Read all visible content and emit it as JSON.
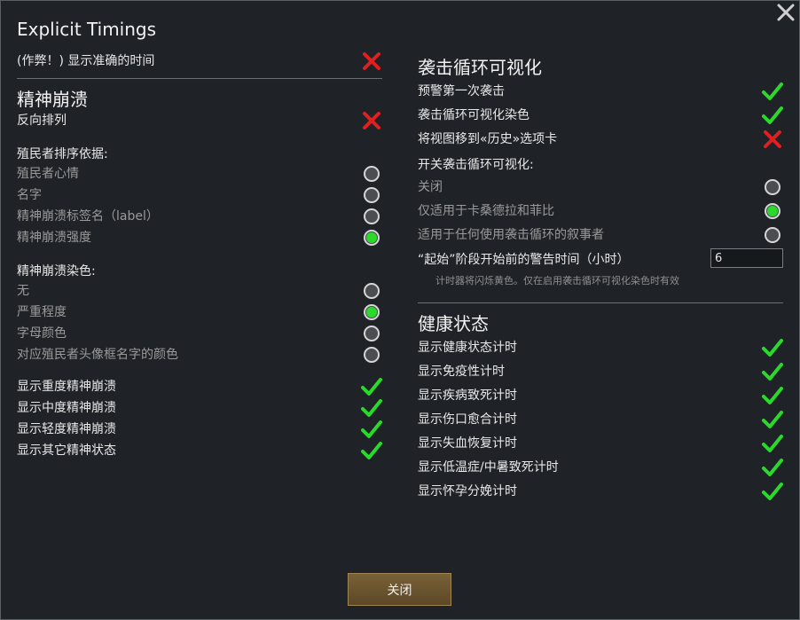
{
  "title": "Explicit Timings",
  "close_button_label": "关闭",
  "left": {
    "cheat_row": {
      "label": "(作弊！) 显示准确的时间",
      "state": "off"
    },
    "mental_header": "精神崩溃",
    "reverse_row": {
      "label": "反向排列",
      "state": "off"
    },
    "sort_header": "殖民者排序依据:",
    "sort_options": [
      {
        "label": "殖民者心情",
        "selected": false
      },
      {
        "label": "名字",
        "selected": false
      },
      {
        "label": "精神崩溃标签名（label）",
        "selected": false
      },
      {
        "label": "精神崩溃强度",
        "selected": true
      }
    ],
    "color_header": "精神崩溃染色:",
    "color_options": [
      {
        "label": "无",
        "selected": false
      },
      {
        "label": "严重程度",
        "selected": true
      },
      {
        "label": "字母颜色",
        "selected": false
      },
      {
        "label": "对应殖民者头像框名字的颜色",
        "selected": false
      }
    ],
    "show_rows": [
      {
        "label": "显示重度精神崩溃",
        "state": "on"
      },
      {
        "label": "显示中度精神崩溃",
        "state": "on"
      },
      {
        "label": "显示轻度精神崩溃",
        "state": "on"
      },
      {
        "label": "显示其它精神状态",
        "state": "on"
      }
    ]
  },
  "right": {
    "raid_header": "袭击循环可视化",
    "raid_rows": [
      {
        "label": "预警第一次袭击",
        "state": "on"
      },
      {
        "label": "袭击循环可视化染色",
        "state": "on"
      },
      {
        "label": "将视图移到«历史»选项卡",
        "state": "off"
      }
    ],
    "toggle_header": "开关袭击循环可视化:",
    "toggle_options": [
      {
        "label": "关闭",
        "selected": false
      },
      {
        "label": "仅适用于卡桑德拉和菲比",
        "selected": true
      },
      {
        "label": "适用于任何使用袭击循环的叙事者",
        "selected": false
      }
    ],
    "warning_row": {
      "label": "“起始”阶段开始前的警告时间（小时）",
      "value": "6"
    },
    "warning_note": "计时器将闪烁黄色。仅在启用袭击循环可视化染色时有效",
    "health_header": "健康状态",
    "health_rows": [
      {
        "label": "显示健康状态计时",
        "state": "on"
      },
      {
        "label": "显示免疫性计时",
        "state": "on"
      },
      {
        "label": "显示疾病致死计时",
        "state": "on"
      },
      {
        "label": "显示伤口愈合计时",
        "state": "on"
      },
      {
        "label": "显示失血恢复计时",
        "state": "on"
      },
      {
        "label": "显示低温症/中暑致死计时",
        "state": "on"
      },
      {
        "label": "显示怀孕分娩计时",
        "state": "on"
      }
    ]
  },
  "colors": {
    "check": "#2bd92b",
    "cross": "#e02020",
    "button": "#6b5430"
  }
}
